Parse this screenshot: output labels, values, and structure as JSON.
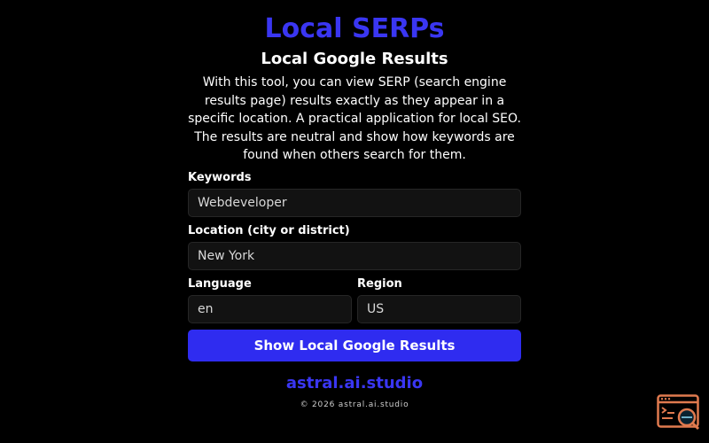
{
  "header": {
    "title": "Local SERPs",
    "subtitle": "Local Google Results",
    "description": "With this tool, you can view SERP (search engine results page) results exactly as they appear in a specific location. A practical application for local SEO. The results are neutral and show how keywords are found when others search for them."
  },
  "form": {
    "keywords": {
      "label": "Keywords",
      "value": "Webdeveloper"
    },
    "location": {
      "label": "Location (city or district)",
      "value": "New York"
    },
    "language": {
      "label": "Language",
      "value": "en"
    },
    "region": {
      "label": "Region",
      "value": "US"
    },
    "submit_label": "Show Local Google Results"
  },
  "footer": {
    "brand": "astral.ai.studio",
    "copyright": "© 2026 astral.ai.studio"
  },
  "widget": {
    "icon": "terminal-search-icon"
  },
  "colors": {
    "accent": "#3a36f2",
    "button": "#2f2cf0",
    "background": "#000000",
    "input_bg": "#121212",
    "widget": "#e07a4f"
  }
}
